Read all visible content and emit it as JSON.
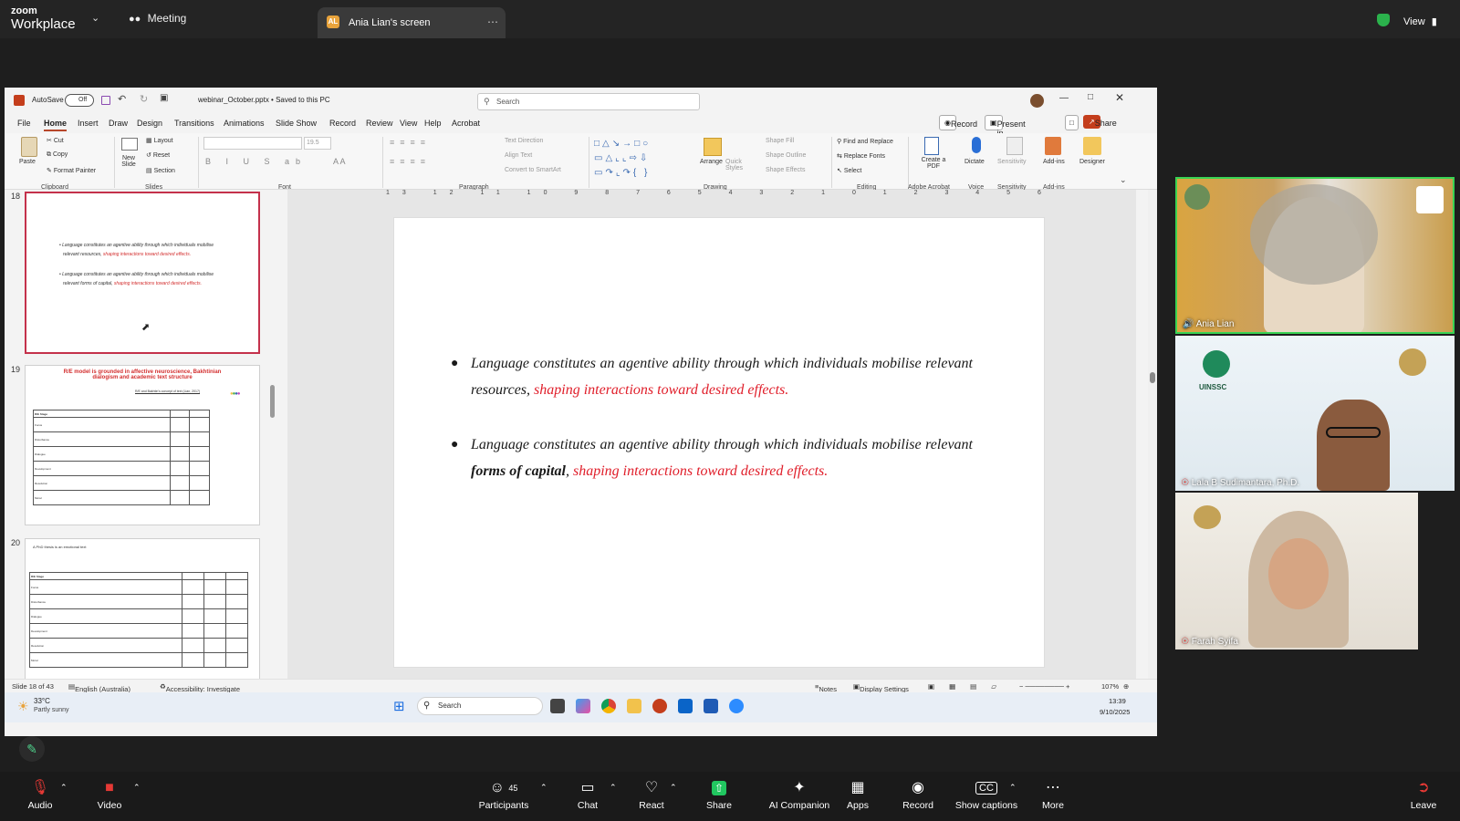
{
  "zoom_top": {
    "brand_small": "zoom",
    "brand": "Workplace",
    "meeting": "Meeting",
    "share_initials": "AL",
    "share_title": "Ania Lian's screen",
    "view": "View"
  },
  "ppt": {
    "autosave": "AutoSave",
    "autosave_state": "Off",
    "filename": "webinar_October.pptx • Saved to this PC",
    "search_placeholder": "Search",
    "menu": [
      "File",
      "Home",
      "Insert",
      "Draw",
      "Design",
      "Transitions",
      "Animations",
      "Slide Show",
      "Record",
      "Review",
      "View",
      "Help",
      "Acrobat"
    ],
    "record_btn": "Record",
    "present_btn": "Present in Teams",
    "share_btn": "Share",
    "ribbon": {
      "clipboard": {
        "paste": "Paste",
        "cut": "Cut",
        "copy": "Copy",
        "format_painter": "Format Painter",
        "group": "Clipboard"
      },
      "slides": {
        "new_slide": "New Slide",
        "layout": "Layout",
        "reset": "Reset",
        "section": "Section",
        "group": "Slides"
      },
      "font": {
        "group": "Font",
        "font_size": "19.5"
      },
      "paragraph": {
        "text_direction": "Text Direction",
        "align_text": "Align Text",
        "convert": "Convert to SmartArt",
        "group": "Paragraph"
      },
      "drawing": {
        "arrange": "Arrange",
        "quick_styles": "Quick Styles",
        "shape_fill": "Shape Fill",
        "shape_outline": "Shape Outline",
        "shape_effects": "Shape Effects",
        "group": "Drawing"
      },
      "editing": {
        "find_replace": "Find and Replace",
        "replace_fonts": "Replace Fonts",
        "select": "Select",
        "group": "Editing"
      },
      "acrobat": {
        "create_pdf": "Create a PDF",
        "group": "Adobe Acrobat"
      },
      "voice": {
        "dictate": "Dictate",
        "group": "Voice"
      },
      "sensitivity": {
        "label": "Sensitivity",
        "group": "Sensitivity"
      },
      "addins": {
        "label": "Add-ins",
        "group": "Add-ins"
      },
      "designer": {
        "label": "Designer"
      }
    },
    "ruler": "13 12 11 10 9 8 7 6 5 4 3 2 1 0 1 2 3 4 5 6 7 8 9 10 11 12 13",
    "thumbnails": [
      {
        "num": "18",
        "lines": [
          {
            "a": "Language constitutes an agentive ability through which individuals mobilise",
            "b": ""
          },
          {
            "a": "relevant resources, ",
            "b": "shaping interactions toward desired effects."
          },
          {
            "a": "Language constitutes an agentive ability through which individuals mobilise",
            "b": ""
          },
          {
            "a": "relevant forms of capital, ",
            "b": "shaping interactions toward desired effects."
          }
        ]
      },
      {
        "num": "19",
        "title": "R/E model is grounded in affective neuroscience, Bakhtinian dialogism and academic text structure",
        "subtitle": "R/E and Bakhtin's concept of text (Lian, 2017)",
        "rows": [
          "R/E Stage",
          "Focus",
          "Disturbance",
          "Dialogue",
          "Development",
          "Resolution",
          "Moral"
        ]
      },
      {
        "num": "20",
        "title": "A PhD thesis is an emotional text",
        "rows": [
          "R/E Stage",
          "Focus",
          "Disturbance",
          "Dialogue",
          "Development",
          "Resolution",
          "Moral"
        ]
      }
    ],
    "slide": {
      "b1_a": "Language constitutes an agentive ability through which individuals mobilise relevant resources,",
      "b1_b": "shaping interactions toward desired effects.",
      "b2_a": "Language constitutes an agentive ability through which individuals mobilise relevant",
      "b2_bold": "forms of capital",
      "b2_b": "shaping interactions toward desired effects."
    },
    "status": {
      "slide_of": "Slide 18 of 43",
      "language": "English (Australia)",
      "accessibility": "Accessibility: Investigate",
      "notes": "Notes",
      "display": "Display Settings",
      "zoom": "107%"
    }
  },
  "taskbar": {
    "weather_temp": "33°C",
    "weather_desc": "Partly sunny",
    "search": "Search",
    "time": "13:39",
    "date": "9/10/2025"
  },
  "participants": [
    {
      "name": "Ania Lian"
    },
    {
      "name": "Lala B Sudimantara, Ph.D."
    },
    {
      "name": "Farah Syifa"
    }
  ],
  "video_text": {
    "uinssc": "UINSSC"
  },
  "zoom_bottom": {
    "audio": "Audio",
    "video": "Video",
    "participants": "Participants",
    "participant_count": "45",
    "chat": "Chat",
    "react": "React",
    "share": "Share",
    "ai": "AI Companion",
    "apps": "Apps",
    "record": "Record",
    "captions": "Show captions",
    "more": "More",
    "leave": "Leave"
  }
}
